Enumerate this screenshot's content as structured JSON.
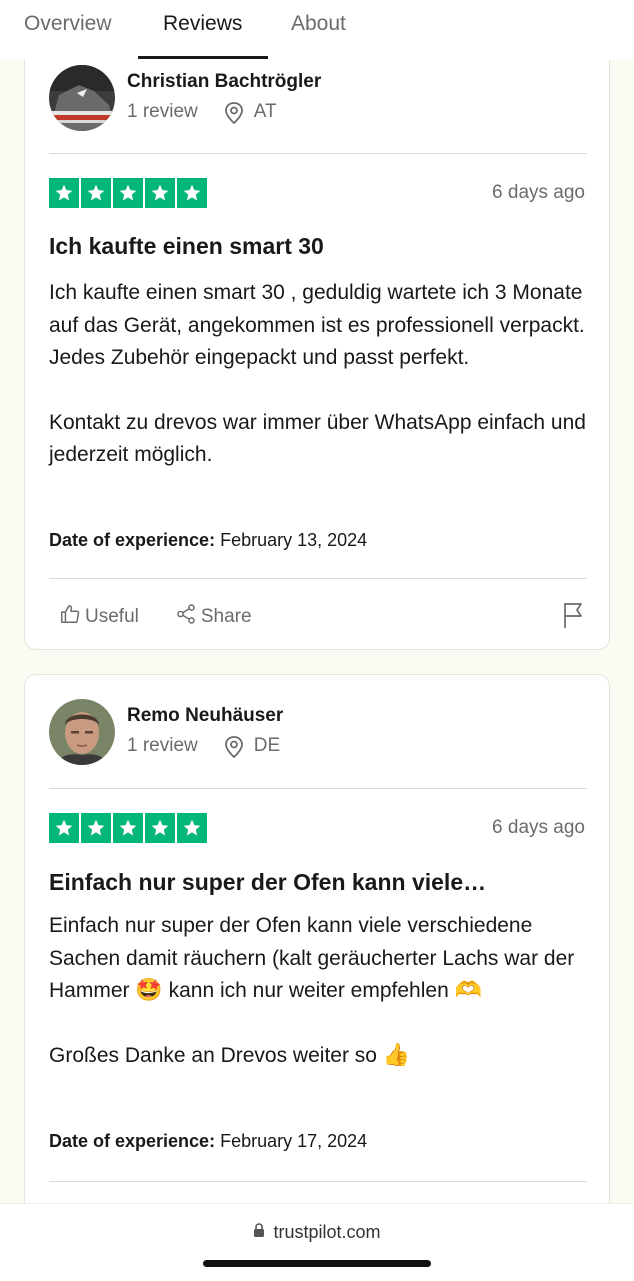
{
  "tabs": [
    {
      "label": "Overview"
    },
    {
      "label": "Reviews"
    },
    {
      "label": "About"
    }
  ],
  "reviews": [
    {
      "reviewer": "Christian Bachtrögler",
      "review_count": "1 review",
      "country": "AT",
      "rating": 5,
      "date_ago": "6 days ago",
      "title": "Ich kaufte einen smart 30",
      "text_p1": "Ich kaufte einen smart 30 , geduldig wartete ich 3 Monate auf das Gerät, angekommen ist es professionell verpackt. Jedes Zubehör eingepackt und passt perfekt.",
      "text_p2": "Kontakt zu drevos war immer über WhatsApp einfach und jederzeit möglich.",
      "doe_label": "Date of experience:",
      "doe_value": "February 13, 2024",
      "useful_label": "Useful",
      "share_label": "Share"
    },
    {
      "reviewer": "Remo Neuhäuser",
      "review_count": "1 review",
      "country": "DE",
      "rating": 5,
      "date_ago": "6 days ago",
      "title": "Einfach nur super der Ofen kann viele…",
      "text_p1_a": "Einfach nur super der Ofen kann viele verschiedene Sachen damit räuchern (kalt geräucherter Lachs war der Hammer ",
      "emoji_1": "🤩",
      "text_p1_b": " kann ich nur weiter empfehlen ",
      "emoji_2": "🫶",
      "text_p2": "Großes Danke an Drevos weiter so ",
      "emoji_3": "👍",
      "doe_label": "Date of experience:",
      "doe_value": "February 17, 2024"
    }
  ],
  "browser": {
    "url": "trustpilot.com"
  },
  "colors": {
    "star_green": "#00b67a",
    "background": "#fbfaf3"
  }
}
